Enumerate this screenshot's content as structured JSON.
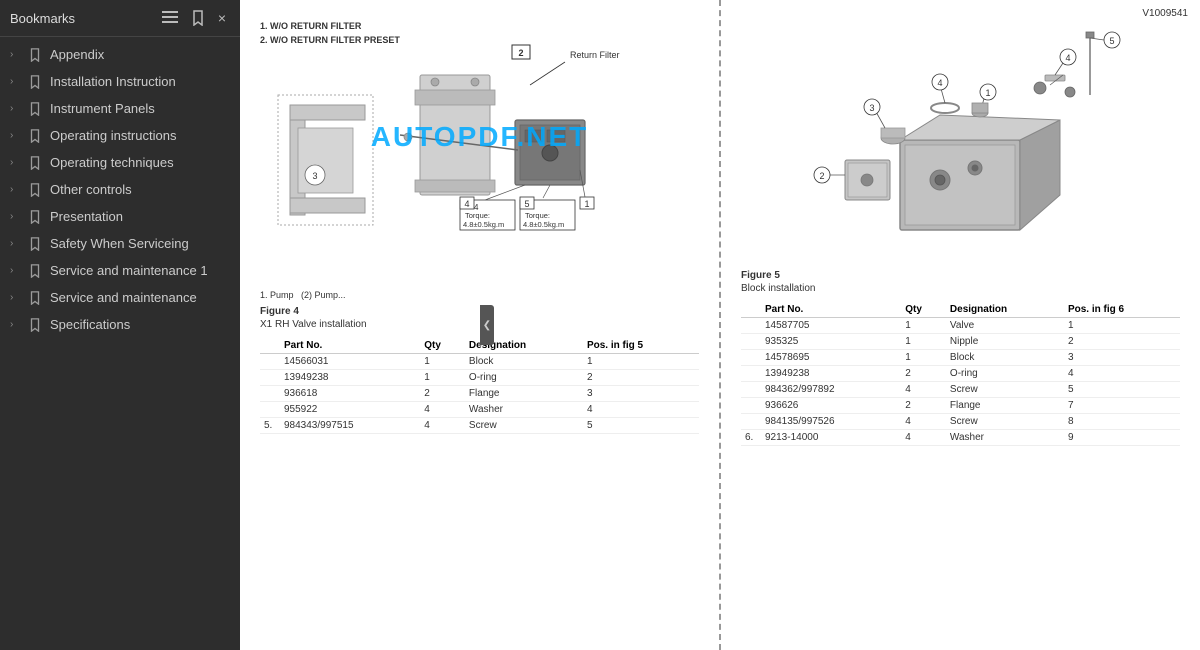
{
  "sidebar": {
    "title": "Bookmarks",
    "items": [
      {
        "id": "appendix",
        "label": "Appendix",
        "hasChildren": true
      },
      {
        "id": "installation-instruction",
        "label": "Installation Instruction",
        "hasChildren": true
      },
      {
        "id": "instrument-panels",
        "label": "Instrument Panels",
        "hasChildren": true
      },
      {
        "id": "operating-instructions",
        "label": "Operating instructions",
        "hasChildren": true
      },
      {
        "id": "operating-techniques",
        "label": "Operating techniques",
        "hasChildren": true
      },
      {
        "id": "other-controls",
        "label": "Other controls",
        "hasChildren": true
      },
      {
        "id": "presentation",
        "label": "Presentation",
        "hasChildren": true
      },
      {
        "id": "safety-when-serviceing",
        "label": "Safety When Serviceing",
        "hasChildren": true
      },
      {
        "id": "service-and-maintenance-1",
        "label": "Service and maintenance 1",
        "hasChildren": true
      },
      {
        "id": "service-and-maintenance",
        "label": "Service and maintenance",
        "hasChildren": true
      },
      {
        "id": "specifications",
        "label": "Specifications",
        "hasChildren": true
      }
    ],
    "close_label": "×"
  },
  "collapse_handle": "❮",
  "left_page": {
    "diagram_labels": {
      "line1": "1. W/O RETURN FILTER",
      "line2": "2. W/O RETURN FILTER PRESET"
    },
    "return_filter_label": "Return Filter",
    "callout_2": "2",
    "callout_3": "3",
    "callout_1": "1",
    "callout_4": "4",
    "callout_5": "5",
    "torque_rows": [
      {
        "num": "4",
        "label": "Torque:",
        "value": "4.8±0.5kg.m"
      },
      {
        "num": "5",
        "label": "Torque:",
        "value": "4.8±0.5kg.m"
      },
      {
        "num": "1",
        "label": "",
        "value": ""
      }
    ],
    "pump_text": "1. Pump (2) Pump...",
    "figure4_label": "Figure 4",
    "figure4_sublabel": "X1 RH Valve installation",
    "table4_headers": [
      "Part No.",
      "Qty",
      "Designation",
      "Pos. in fig 5"
    ],
    "table4_rows": [
      {
        "pos": "",
        "partno": "14566031",
        "qty": "1",
        "designation": "Block",
        "posfig": "1"
      },
      {
        "pos": "",
        "partno": "13949238",
        "qty": "1",
        "designation": "O-ring",
        "posfig": "2"
      },
      {
        "pos": "",
        "partno": "936618",
        "qty": "2",
        "designation": "Flange",
        "posfig": "3"
      },
      {
        "pos": "",
        "partno": "955922",
        "qty": "4",
        "designation": "Washer",
        "posfig": "4"
      },
      {
        "pos": "5.",
        "partno": "984343/997515",
        "qty": "4",
        "designation": "Screw",
        "posfig": "5"
      }
    ],
    "watermark": "AUTOPDF.NET"
  },
  "right_page": {
    "callout_1": "1",
    "callout_2": "2",
    "callout_3": "3",
    "callout_4a": "4",
    "callout_4b": "4",
    "callout_5": "5",
    "page_ref": "V1009541",
    "figure5_label": "Figure 5",
    "figure5_sublabel": "Block installation",
    "table5_headers": [
      "Part No.",
      "Qty",
      "Designation",
      "Pos. in fig 6"
    ],
    "table5_rows": [
      {
        "pos": "",
        "partno": "14587705",
        "qty": "1",
        "designation": "Valve",
        "posfig": "1"
      },
      {
        "pos": "",
        "partno": "935325",
        "qty": "1",
        "designation": "Nipple",
        "posfig": "2"
      },
      {
        "pos": "",
        "partno": "14578695",
        "qty": "1",
        "designation": "Block",
        "posfig": "3"
      },
      {
        "pos": "",
        "partno": "13949238",
        "qty": "2",
        "designation": "O-ring",
        "posfig": "4"
      },
      {
        "pos": "",
        "partno": "984362/997892",
        "qty": "4",
        "designation": "Screw",
        "posfig": "5"
      },
      {
        "pos": "",
        "partno": "936626",
        "qty": "2",
        "designation": "Flange",
        "posfig": "7"
      },
      {
        "pos": "",
        "partno": "984135/997526",
        "qty": "4",
        "designation": "Screw",
        "posfig": "8"
      },
      {
        "pos": "6.",
        "partno": "9213-14000",
        "qty": "4",
        "designation": "Washer",
        "posfig": "9"
      }
    ]
  }
}
